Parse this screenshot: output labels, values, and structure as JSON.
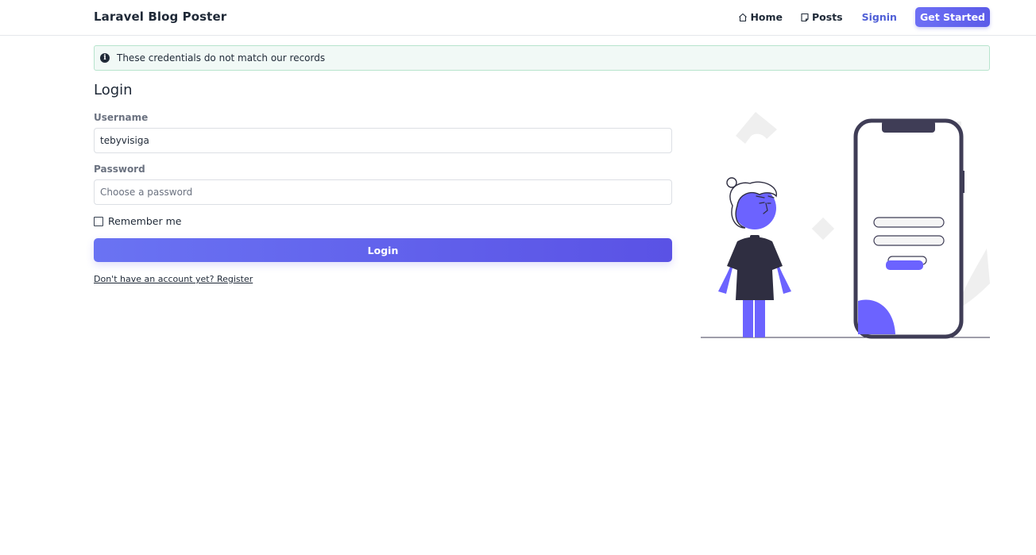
{
  "navbar": {
    "brand": "Laravel Blog Poster",
    "links": [
      {
        "label": "Home",
        "icon": "home-icon"
      },
      {
        "label": "Posts",
        "icon": "posts-icon"
      },
      {
        "label": "Signin"
      }
    ],
    "cta_label": "Get Started"
  },
  "alert": {
    "icon": "info-icon",
    "glyph": "i",
    "message": "These credentials do not match our records"
  },
  "form": {
    "title": "Login",
    "username": {
      "label": "Username",
      "value": "tebyvisiga"
    },
    "password": {
      "label": "Password",
      "placeholder": "Choose a password",
      "value": ""
    },
    "remember_label": "Remember me",
    "remember_checked": false,
    "submit_label": "Login",
    "register_link": "Don't have an account yet? Register"
  },
  "colors": {
    "accent": "#6c63ff",
    "dark": "#2f2e41",
    "link": "#4f5fd6",
    "alert_bg": "#f1f9f6",
    "alert_border": "#b7e4cd"
  }
}
